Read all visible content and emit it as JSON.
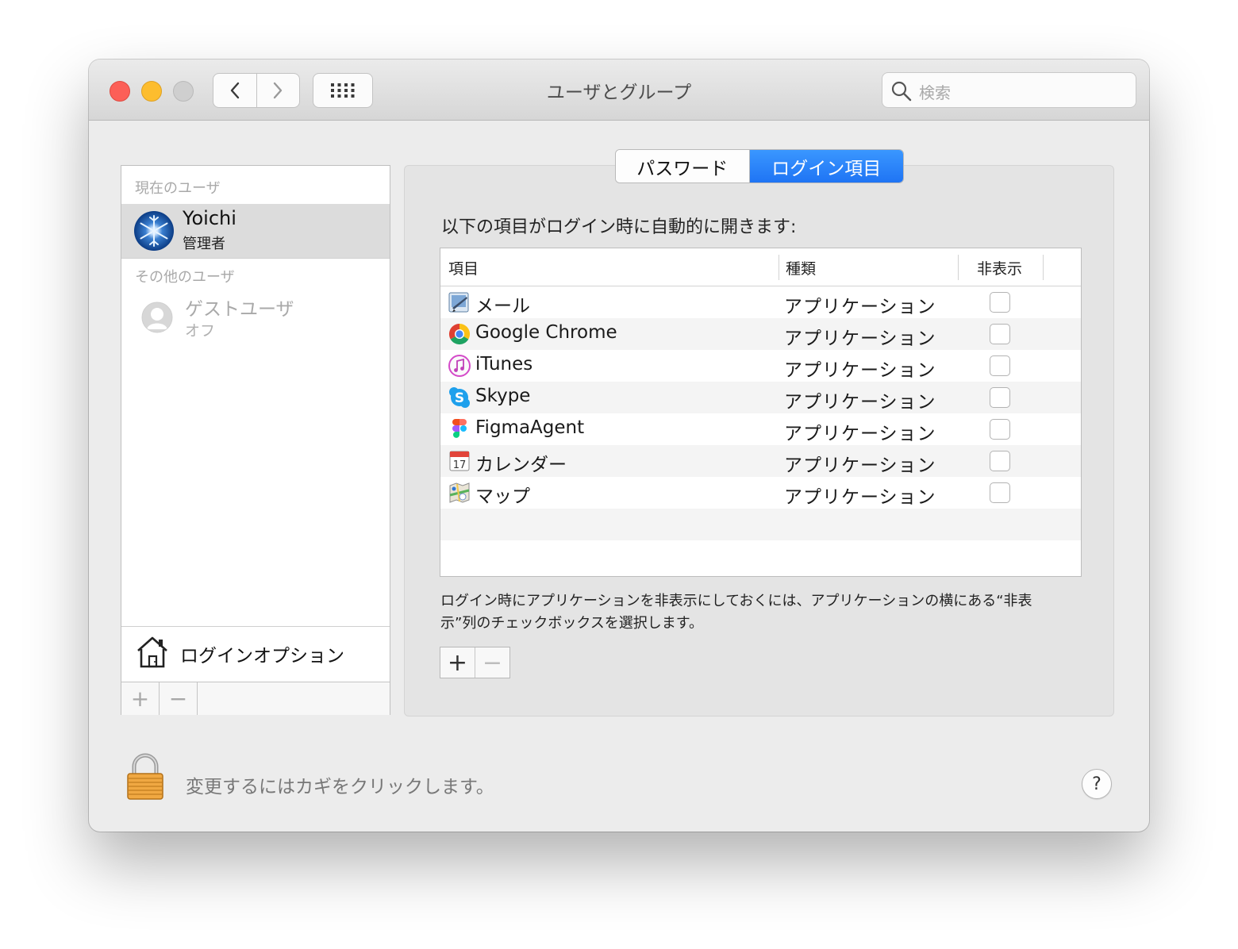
{
  "window": {
    "title": "ユーザとグループ"
  },
  "toolbar": {
    "back_icon": "chevron-left-icon",
    "forward_icon": "chevron-right-icon",
    "grid_icon": "show-all-grid-icon",
    "search_placeholder": "検索"
  },
  "sidebar": {
    "current_section": "現在のユーザ",
    "current_user": {
      "name": "Yoichi",
      "role": "管理者"
    },
    "other_section": "その他のユーザ",
    "guest_user": {
      "name": "ゲストユーザ",
      "state": "オフ"
    },
    "login_options": "ログインオプション",
    "add_label": "+",
    "remove_label": "−"
  },
  "tabs": {
    "password": "パスワード",
    "login_items": "ログイン項目",
    "selected": "ログイン項目"
  },
  "login_items": {
    "heading": "以下の項目がログイン時に自動的に開きます:",
    "columns": {
      "item": "項目",
      "kind": "種類",
      "hide": "非表示"
    },
    "rows": [
      {
        "name": "メール",
        "kind": "アプリケーション",
        "hidden": false,
        "icon": "mail-app-icon"
      },
      {
        "name": "Google Chrome",
        "kind": "アプリケーション",
        "hidden": false,
        "icon": "chrome-app-icon"
      },
      {
        "name": "iTunes",
        "kind": "アプリケーション",
        "hidden": false,
        "icon": "itunes-app-icon"
      },
      {
        "name": "Skype",
        "kind": "アプリケーション",
        "hidden": false,
        "icon": "skype-app-icon"
      },
      {
        "name": "FigmaAgent",
        "kind": "アプリケーション",
        "hidden": false,
        "icon": "figma-app-icon"
      },
      {
        "name": "カレンダー",
        "kind": "アプリケーション",
        "hidden": false,
        "icon": "calendar-app-icon"
      },
      {
        "name": "マップ",
        "kind": "アプリケーション",
        "hidden": false,
        "icon": "maps-app-icon"
      }
    ],
    "hint": "ログイン時にアプリケーションを非表示にしておくには、アプリケーションの横にある“非表示”列のチェックボックスを選択します。",
    "add_label": "+",
    "remove_label": "−"
  },
  "footer": {
    "lock_text": "変更するにはカギをクリックします。",
    "help_label": "?"
  },
  "colors": {
    "accent": "#1f74f4",
    "close": "#fc5f57",
    "minimize": "#fdbd2e"
  }
}
